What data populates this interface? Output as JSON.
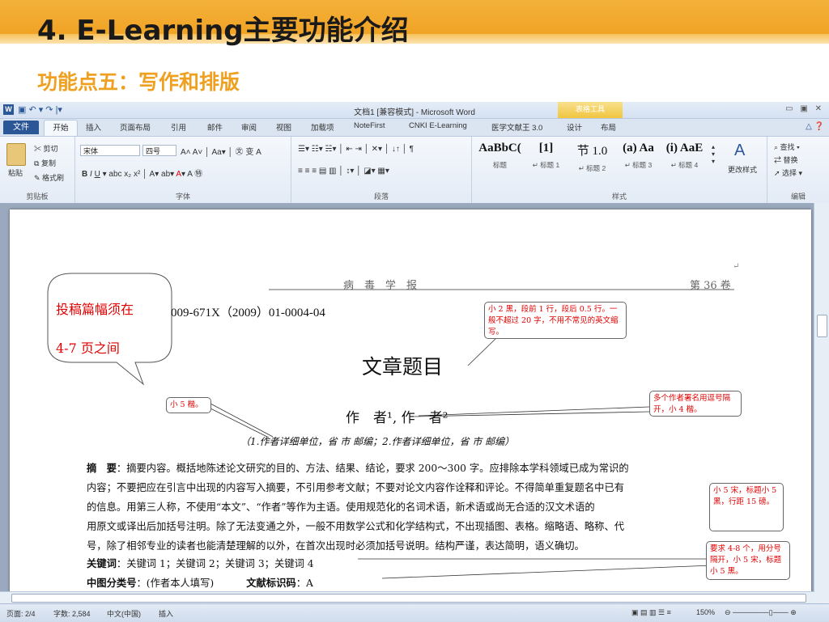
{
  "slide": {
    "title": "4. E-Learning主要功能介绍",
    "subtitle": "功能点五：写作和排版"
  },
  "window": {
    "title": "文档1 [兼容模式] - Microsoft Word",
    "context_tool": "表格工具",
    "qat": "▣ ↶ ▾ ↷ |▾"
  },
  "tabs": [
    "文件",
    "开始",
    "插入",
    "页面布局",
    "引用",
    "邮件",
    "审阅",
    "视图",
    "加载项",
    "NoteFirst",
    "CNKI E-Learning",
    "医学文献王 3.0",
    "设计",
    "布局"
  ],
  "ribbon": {
    "clipboard": {
      "label": "剪贴板",
      "paste": "粘贴",
      "cut": "剪切",
      "copy": "复制",
      "format_painter": "格式刷"
    },
    "font": {
      "label": "字体",
      "font_name": "宋体",
      "font_size": "四号"
    },
    "paragraph": {
      "label": "段落"
    },
    "styles": {
      "label": "样式",
      "items": [
        {
          "sample": "AaBbC(",
          "name": "标题"
        },
        {
          "sample": "[1]",
          "name": "↵ 标题 1"
        },
        {
          "sample": "节 1.0",
          "name": "↵ 标题 2"
        },
        {
          "sample": "(a) Aa",
          "name": "↵ 标题 3"
        },
        {
          "sample": "(i) AaE",
          "name": "↵ 标题 4"
        }
      ],
      "change_styles": "更改样式"
    },
    "editing": {
      "label": "编辑",
      "find": "查找 ▾",
      "replace": "替换",
      "select": "选择 ▾"
    }
  },
  "document": {
    "header_journal": "病　毒　学　报",
    "header_volume": "第 36 卷",
    "issn": "009-671X（2009）01-0004-04",
    "article_title": "文章题目",
    "authors": "作　者¹, 作　者²",
    "affiliation": "（1.作者详细单位，省 市 邮编；2.作者详细单位，省 市 邮编）",
    "abstract_label": "摘　要",
    "abstract_lines": [
      "：摘要内容。概括地陈述论文研究的目的、方法、结果、结论，要求 200～300 字。应排除本学科领域已成为常识的",
      "内容；不要把应在引言中出现的内容写入摘要，不引用参考文献；不要对论文内容作诠释和评论。不得简单重复题名中已有",
      "的信息。用第三人称，不使用“本文”、“作者”等作为主语。使用规范化的名词术语，新术语或尚无合适的汉文术语的",
      "用原文或译出后加括号注明。除了无法变通之外，一般不用数学公式和化学结构式，不出现插图、表格。缩略语、略称、代",
      "号，除了相邻专业的读者也能清楚理解的以外，在首次出现时必须加括号说明。结构严谨，表达简明，语义确切。"
    ],
    "keywords_label": "关键词",
    "keywords": "：关键词 1；关键词 2；关键词 3；关键词 4",
    "clc_label": "中图分类号",
    "clc_value": "：(作者本人填写)",
    "doc_id_label": "文献标识码",
    "doc_id_value": "：A"
  },
  "annotations": {
    "callout_line1": "投稿篇幅须在",
    "callout_line2": "4-7 页之间",
    "note_title": "小 2 黑，段前 1 行，段后 0.5 行。一般不超过 20 字，不用不常见的英文缩写。",
    "note_affil": "小 5 楷。",
    "note_authors": "多个作者署名用逗号隔开，小 4 楷。",
    "note_abstract": "小 5 宋，标题小 5 黑，行距 15 磅。",
    "note_keywords": "要求 4-8 个，用分号隔开，小 5 宋，标题小 5 黑。"
  },
  "status": {
    "page": "页面: 2/4",
    "words": "字数: 2,584",
    "lang": "中文(中国)",
    "mode": "插入",
    "zoom": "150%"
  },
  "colors": {
    "slide_orange": "#f0a020",
    "word_blue": "#2b5797",
    "note_red": "#e00000"
  }
}
